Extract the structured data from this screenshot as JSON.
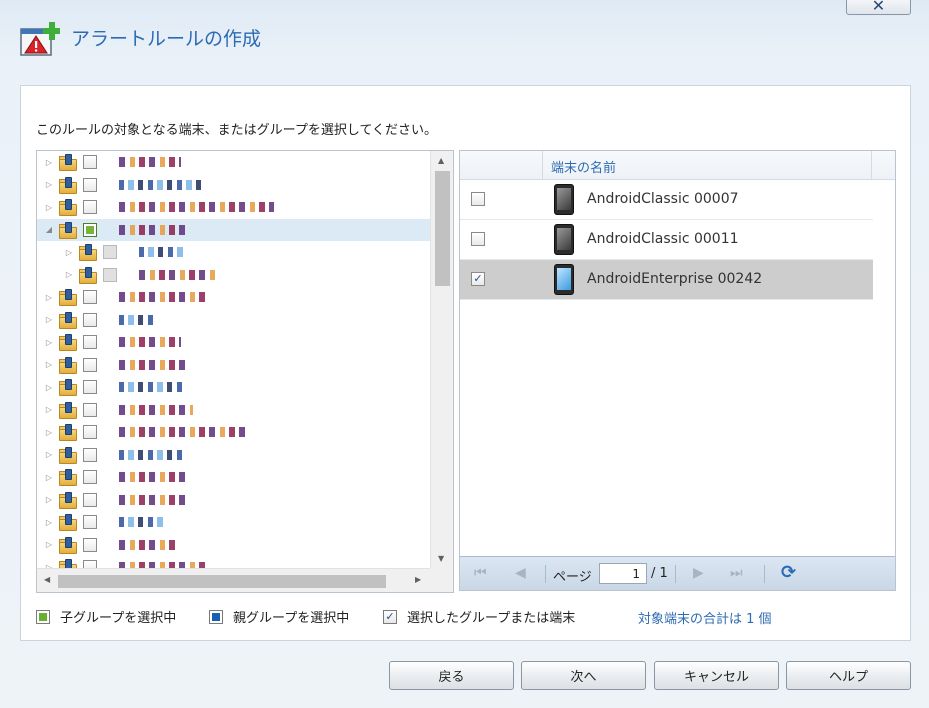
{
  "window": {
    "title": "アラートルールの作成",
    "close_label": "✕"
  },
  "instruction": "このルールの対象となる端末、またはグループを選択してください。",
  "tree": {
    "rows": [
      {
        "state": "collapsed",
        "check": "none"
      },
      {
        "state": "collapsed",
        "check": "none"
      },
      {
        "state": "collapsed",
        "check": "none"
      },
      {
        "state": "expanded",
        "check": "child-selected"
      },
      {
        "state": "collapsed",
        "check": "grey"
      },
      {
        "state": "collapsed",
        "check": "grey"
      },
      {
        "state": "collapsed",
        "check": "none"
      },
      {
        "state": "collapsed",
        "check": "none"
      },
      {
        "state": "collapsed",
        "check": "none"
      },
      {
        "state": "collapsed",
        "check": "none"
      },
      {
        "state": "collapsed",
        "check": "none"
      },
      {
        "state": "collapsed",
        "check": "none"
      },
      {
        "state": "collapsed",
        "check": "none"
      },
      {
        "state": "collapsed",
        "check": "none"
      },
      {
        "state": "collapsed",
        "check": "none"
      },
      {
        "state": "collapsed",
        "check": "none"
      },
      {
        "state": "collapsed",
        "check": "none"
      },
      {
        "state": "collapsed",
        "check": "none"
      },
      {
        "state": "collapsed",
        "check": "none"
      }
    ]
  },
  "grid": {
    "column_header": "端末の名前",
    "rows": [
      {
        "name": "AndroidClassic 00007",
        "checked": false,
        "type": "classic"
      },
      {
        "name": "AndroidClassic 00011",
        "checked": false,
        "type": "classic"
      },
      {
        "name": "AndroidEnterprise 00242",
        "checked": true,
        "type": "enterprise"
      }
    ],
    "pager": {
      "page_label": "ページ",
      "current_page": "1",
      "total_pages": "/ 1"
    }
  },
  "legend": {
    "child_selected": "子グループを選択中",
    "parent_selected": "親グループを選択中",
    "selected": "選択したグループまたは端末",
    "total": "対象端末の合計は 1 個"
  },
  "buttons": {
    "back": "戻る",
    "next": "次へ",
    "cancel": "キャンセル",
    "help": "ヘルプ"
  },
  "colors": {
    "accent": "#2d6bb3",
    "child_green": "#6ab02e",
    "parent_blue": "#1b5fb3",
    "selected_row": "#cdcdcd"
  }
}
